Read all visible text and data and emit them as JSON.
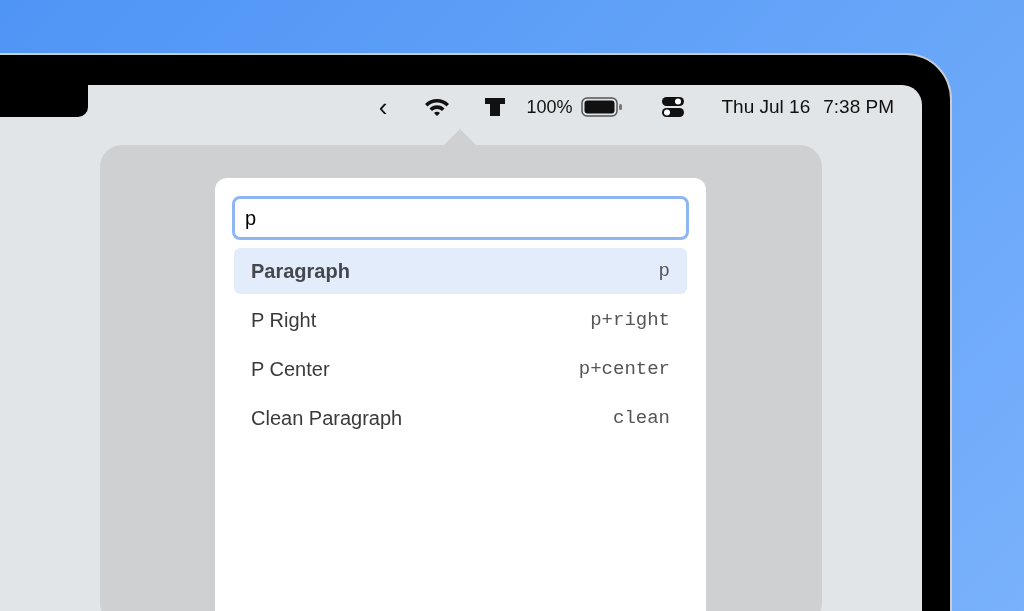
{
  "menu_bar": {
    "collapse_arrow": "‹",
    "battery_percent": "100%",
    "date": "Thu Jul 16",
    "time": "7:38 PM"
  },
  "search": {
    "value": "p"
  },
  "results": [
    {
      "label": "Paragraph",
      "shortcut": "p",
      "selected": true
    },
    {
      "label": "P Right",
      "shortcut": "p+right",
      "selected": false
    },
    {
      "label": "P Center",
      "shortcut": "p+center",
      "selected": false
    },
    {
      "label": "Clean Paragraph",
      "shortcut": "clean",
      "selected": false
    }
  ]
}
